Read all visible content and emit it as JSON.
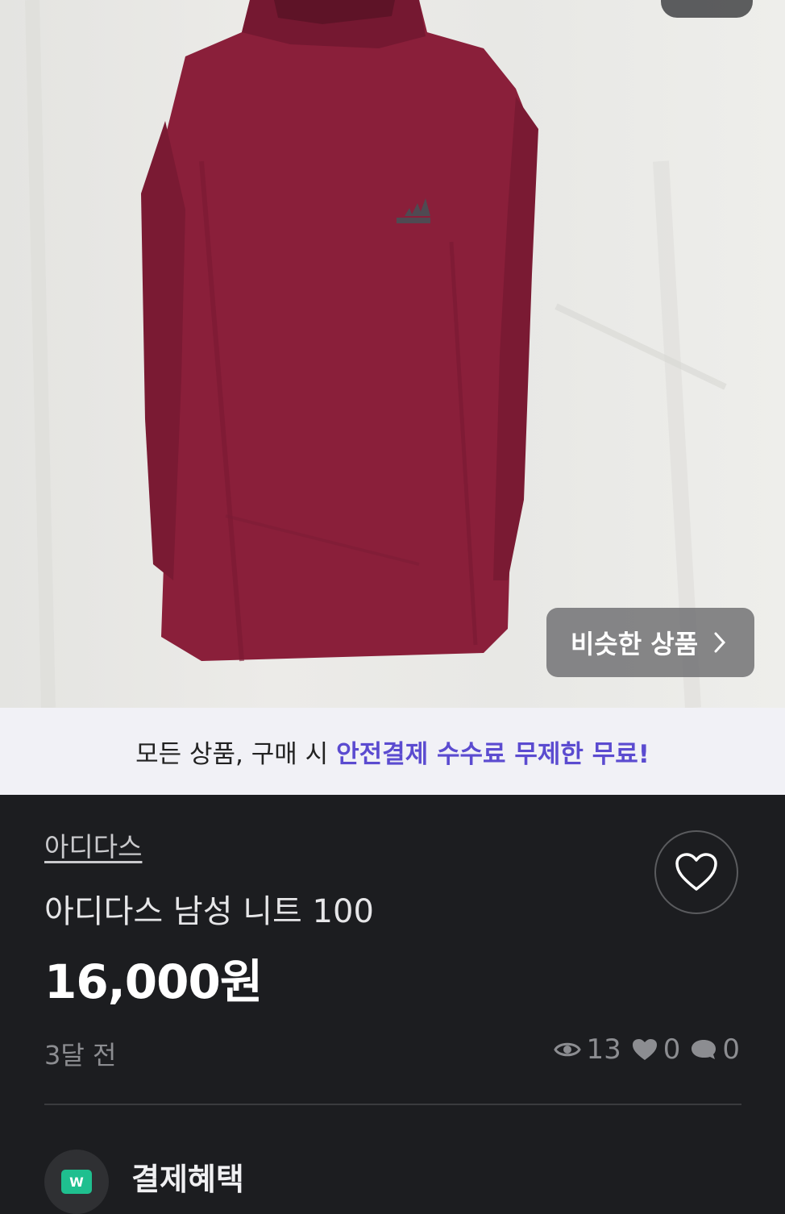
{
  "product_image": {
    "alt": "item photo"
  },
  "similar_button": {
    "label": "비슷한 상품"
  },
  "banner": {
    "text": "모든 상품, 구매 시",
    "highlight": "안전결제 수수료 무제한 무료!"
  },
  "product": {
    "brand": "아디다스",
    "title": "아디다스 남성 니트 100",
    "price": "16,000원",
    "posted": "3달 전"
  },
  "stats": {
    "views": "13",
    "likes": "0",
    "chats": "0"
  },
  "payment": {
    "label": "결제혜택",
    "icon_text": "W"
  },
  "colors": {
    "accent": "#5b4bd0",
    "dark_bg": "#1c1d20",
    "pay_green": "#1fbf8f",
    "shirt": "#8a1f3a"
  },
  "icons": [
    "chevron-right-icon",
    "heart-icon",
    "eye-icon",
    "heart-small-icon",
    "chat-icon",
    "payment-icon"
  ]
}
